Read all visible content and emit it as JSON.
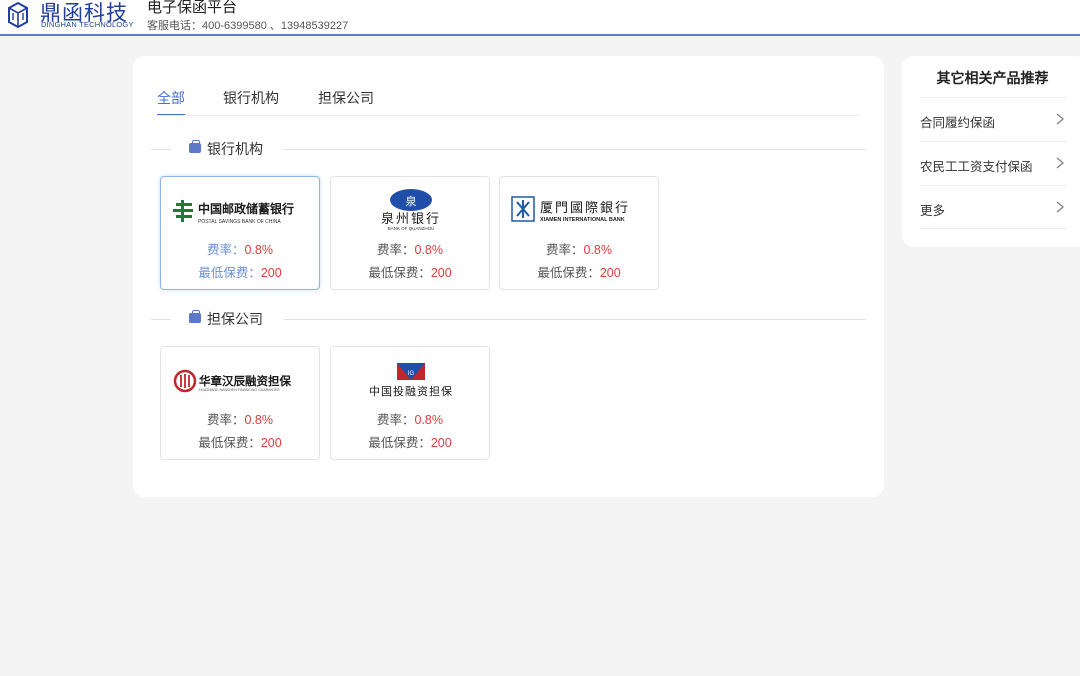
{
  "header": {
    "logo_text": "鼎函科技",
    "logo_sub": "DINGHAN TECHNOLOGY",
    "platform_title": "电子保函平台",
    "service_tel": "客服电话：400-6399580 、13948539227"
  },
  "tabs": [
    {
      "label": "全部",
      "active": true
    },
    {
      "label": "银行机构",
      "active": false
    },
    {
      "label": "担保公司",
      "active": false
    }
  ],
  "sections": [
    {
      "title": "银行机构",
      "items": [
        {
          "logo_main": "中国邮政储蓄银行",
          "logo_sub": "POSTAL SAVINGS BANK OF CHINA",
          "rate_label": "费率：",
          "rate_value": "0.8%",
          "fee_label": "最低保费：",
          "fee_value": "200",
          "selected": true
        },
        {
          "logo_main": "泉州银行",
          "logo_sub": "BANK OF QUANZHOU",
          "rate_label": "费率：",
          "rate_value": "0.8%",
          "fee_label": "最低保费：",
          "fee_value": "200",
          "selected": false
        },
        {
          "logo_main": "厦門國際銀行",
          "logo_sub": "XIAMEN INTERNATIONAL BANK",
          "rate_label": "费率：",
          "rate_value": "0.8%",
          "fee_label": "最低保费：",
          "fee_value": "200",
          "selected": false
        }
      ]
    },
    {
      "title": "担保公司",
      "items": [
        {
          "logo_main": "华章汉辰融资担保",
          "logo_sub": "HUAZHANG HANCHEN FINANCING GUARANTEE",
          "rate_label": "费率：",
          "rate_value": "0.8%",
          "fee_label": "最低保费：",
          "fee_value": "200",
          "selected": false
        },
        {
          "logo_main": "中国投融资担保",
          "logo_sub": "",
          "rate_label": "费率：",
          "rate_value": "0.8%",
          "fee_label": "最低保费：",
          "fee_value": "200",
          "selected": false
        }
      ]
    }
  ],
  "side_panel": {
    "title": "其它相关产品推荐",
    "items": [
      {
        "label": "合同履约保函"
      },
      {
        "label": "农民工工资支付保函"
      },
      {
        "label": "更多"
      }
    ]
  },
  "colors": {
    "accent": "#4a6fd1",
    "value_red": "#e03c3c",
    "brand_blue": "#1f3f9a"
  }
}
